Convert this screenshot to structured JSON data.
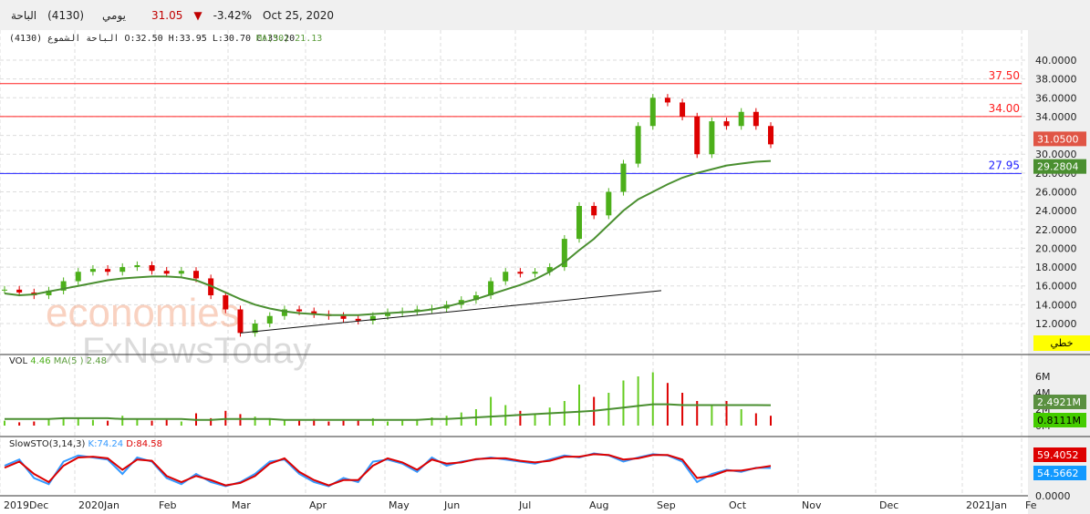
{
  "header": {
    "name": "الباحة",
    "code": "(4130)",
    "period": "يومي",
    "price": "31.05",
    "change": "-3.42%",
    "date": "Oct 25, 2020",
    "down_color": "#c00000"
  },
  "legend": {
    "name": "الباحة الشموع (4130)",
    "open": "O:32.50",
    "high": "H:33.95",
    "low": "L:30.70",
    "close": "C:33.20",
    "ma_label": "MA(50)",
    "ma_value": "21.13"
  },
  "vol_legend": {
    "label": "VOL",
    "value": "4.46",
    "ma_label": "MA(5 )",
    "ma_value": "2.48"
  },
  "stoch_legend": {
    "label": "SlowSTO(3,14,3)",
    "k": "K:74.24",
    "d": "D:84.58"
  },
  "watermark": {
    "line1": "economies",
    "line2": "FxNewsToday"
  },
  "linear_badge": "خطي",
  "chart_data": {
    "type": "candlestick",
    "ylim": [
      10,
      41
    ],
    "y_ticks": [
      "12.0000",
      "14.0000",
      "16.0000",
      "18.0000",
      "20.0000",
      "22.0000",
      "24.0000",
      "26.0000",
      "28.0000",
      "30.0000",
      "32.0000",
      "34.0000",
      "36.0000",
      "38.0000",
      "40.0000"
    ],
    "x_labels": [
      "2019Dec",
      "2020Jan",
      "Feb",
      "Mar",
      "Apr",
      "May",
      "Jun",
      "Jul",
      "Aug",
      "Sep",
      "Oct",
      "Nov",
      "Dec",
      "2021Jan",
      "Fe"
    ],
    "closes": [
      15.6,
      15.3,
      15.0,
      15.5,
      16.5,
      17.5,
      17.8,
      17.5,
      18.0,
      18.2,
      17.6,
      17.3,
      17.6,
      16.8,
      15.0,
      13.5,
      11.0,
      12.0,
      12.8,
      13.5,
      13.3,
      13.0,
      12.8,
      12.5,
      12.3,
      12.8,
      13.2,
      13.3,
      13.5,
      13.6,
      14.0,
      14.5,
      15.0,
      16.5,
      17.5,
      17.3,
      17.5,
      18.0,
      21.0,
      24.5,
      23.5,
      26.0,
      29.0,
      33.0,
      36.0,
      35.5,
      34.0,
      30.0,
      33.5,
      33.0,
      34.5,
      33.0,
      31.05
    ],
    "ma50": [
      15.2,
      15.0,
      15.1,
      15.4,
      15.7,
      16.0,
      16.3,
      16.6,
      16.8,
      16.9,
      17.0,
      17.0,
      16.9,
      16.6,
      16.0,
      15.3,
      14.6,
      14.0,
      13.6,
      13.3,
      13.1,
      13.0,
      12.9,
      12.9,
      12.9,
      13.0,
      13.1,
      13.2,
      13.3,
      13.5,
      13.8,
      14.2,
      14.6,
      15.1,
      15.6,
      16.1,
      16.7,
      17.5,
      18.5,
      19.8,
      21.0,
      22.5,
      24.0,
      25.2,
      26.0,
      26.8,
      27.5,
      28.0,
      28.4,
      28.8,
      29.0,
      29.2,
      29.28
    ],
    "trendline": {
      "from": [
        11,
        16.6
      ],
      "to": [
        15.5,
        55
      ]
    },
    "hlines": [
      {
        "value": 37.5,
        "label": "37.50",
        "color": "#ff2020"
      },
      {
        "value": 34.0,
        "label": "34.00",
        "color": "#ff2020"
      },
      {
        "value": 27.95,
        "label": "27.95",
        "color": "#2020ff"
      }
    ],
    "last_price_tag": "31.0500",
    "ma_tag": "29.2804",
    "volume": {
      "ylim": [
        0,
        7.5
      ],
      "ticks": [
        "6M",
        "4M",
        "2M",
        "0M"
      ],
      "values": [
        0.6,
        0.4,
        0.5,
        0.8,
        1.0,
        0.9,
        0.7,
        0.6,
        1.2,
        0.8,
        0.6,
        0.7,
        0.5,
        1.5,
        0.9,
        1.8,
        1.4,
        1.1,
        0.9,
        0.7,
        0.6,
        0.8,
        0.5,
        0.6,
        0.7,
        0.9,
        0.5,
        0.6,
        0.8,
        1.0,
        1.2,
        1.6,
        2.0,
        3.5,
        2.5,
        1.8,
        1.5,
        2.2,
        3.0,
        5.0,
        3.5,
        4.0,
        5.5,
        6.0,
        6.5,
        5.2,
        4.0,
        3.0,
        2.5,
        3.0,
        2.0,
        1.5,
        1.2
      ],
      "ma": [
        0.8,
        0.8,
        0.8,
        0.8,
        0.9,
        0.9,
        0.9,
        0.9,
        0.8,
        0.8,
        0.8,
        0.8,
        0.8,
        0.7,
        0.7,
        0.8,
        0.8,
        0.8,
        0.8,
        0.7,
        0.7,
        0.7,
        0.7,
        0.7,
        0.7,
        0.7,
        0.7,
        0.7,
        0.7,
        0.8,
        0.8,
        0.9,
        1.0,
        1.1,
        1.2,
        1.3,
        1.4,
        1.5,
        1.6,
        1.7,
        1.8,
        2.0,
        2.2,
        2.4,
        2.6,
        2.6,
        2.5,
        2.5,
        2.5,
        2.5,
        2.5,
        2.5,
        2.49
      ],
      "tag_ma": "2.4921M",
      "tag_vol": "0.8111M"
    },
    "stoch": {
      "ylim": [
        0,
        100
      ],
      "ticks": [
        "0.0000"
      ],
      "k": [
        60,
        75,
        30,
        15,
        70,
        85,
        80,
        75,
        40,
        80,
        70,
        30,
        15,
        40,
        20,
        10,
        20,
        40,
        70,
        75,
        40,
        20,
        10,
        30,
        20,
        70,
        75,
        65,
        45,
        80,
        60,
        70,
        75,
        80,
        75,
        70,
        65,
        75,
        85,
        80,
        90,
        85,
        70,
        80,
        88,
        85,
        70,
        20,
        40,
        50,
        45,
        55,
        54.57
      ],
      "d": [
        55,
        70,
        40,
        20,
        60,
        80,
        82,
        78,
        50,
        75,
        72,
        35,
        20,
        35,
        25,
        12,
        18,
        35,
        65,
        78,
        45,
        25,
        12,
        25,
        25,
        60,
        78,
        68,
        50,
        75,
        65,
        68,
        76,
        78,
        78,
        72,
        68,
        72,
        82,
        82,
        88,
        86,
        75,
        78,
        86,
        86,
        75,
        30,
        35,
        48,
        48,
        54,
        59.41
      ],
      "tag_d": "59.4052",
      "tag_k": "54.5662"
    }
  }
}
